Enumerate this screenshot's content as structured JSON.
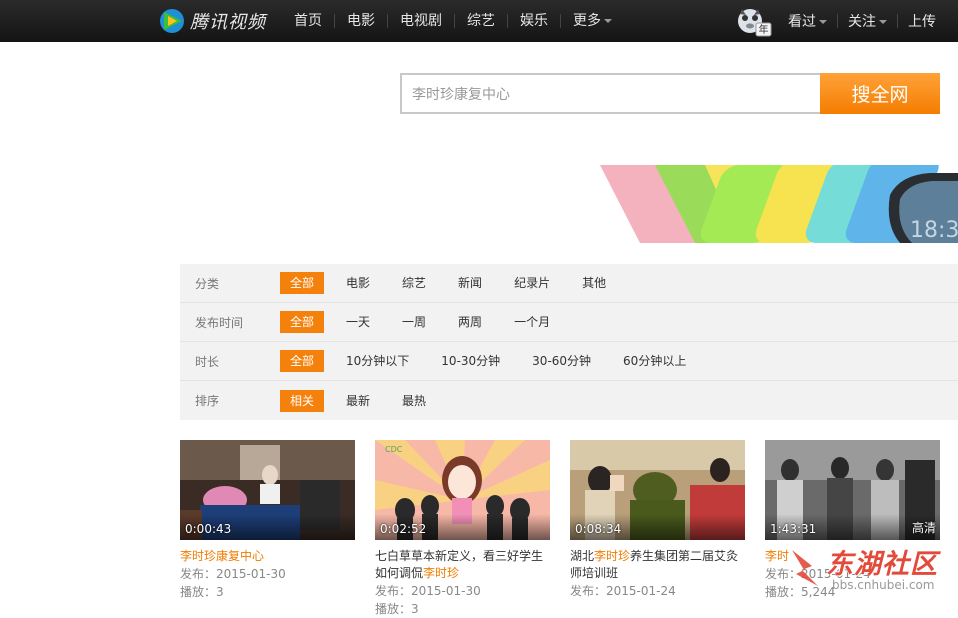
{
  "header": {
    "logo_text": "腾讯视频",
    "nav": [
      "首页",
      "电影",
      "电视剧",
      "综艺",
      "娱乐",
      "更多"
    ],
    "user_menu": [
      "看过",
      "关注",
      "上传"
    ],
    "avatar_badge": "年"
  },
  "search": {
    "value": "李时珍康复中心",
    "button_label": "搜全网"
  },
  "filters": [
    {
      "label": "分类",
      "options": [
        "全部",
        "电影",
        "综艺",
        "新闻",
        "纪录片",
        "其他"
      ],
      "active": 0
    },
    {
      "label": "发布时间",
      "options": [
        "全部",
        "一天",
        "一周",
        "两周",
        "一个月"
      ],
      "active": 0
    },
    {
      "label": "时长",
      "options": [
        "全部",
        "10分钟以下",
        "10-30分钟",
        "30-60分钟",
        "60分钟以上"
      ],
      "active": 0
    },
    {
      "label": "排序",
      "options": [
        "相关",
        "最新",
        "最热"
      ],
      "active": 0
    }
  ],
  "videos": [
    {
      "duration": "0:00:43",
      "hd": "",
      "title_parts": [
        "",
        "李时珍康复中心",
        ""
      ],
      "publish": "发布：2015-01-30",
      "plays": "播放：3"
    },
    {
      "duration": "0:02:52",
      "hd": "",
      "title_parts": [
        "七白草草本新定义，看三好学生如何调侃",
        "李时珍",
        ""
      ],
      "publish": "发布：2015-01-30",
      "plays": "播放：3"
    },
    {
      "duration": "0:08:34",
      "hd": "",
      "title_parts": [
        "湖北",
        "李时珍",
        "养生集团第二届艾灸师培训班"
      ],
      "publish": "发布：2015-01-24",
      "plays": ""
    },
    {
      "duration": "1:43:31",
      "hd": "高清",
      "title_parts": [
        "",
        "李时",
        ""
      ],
      "publish": "发布：2015-01-24",
      "plays": "播放：5,244"
    }
  ],
  "watermark": {
    "text": "东湖社区",
    "url": "bbs.cnhubei.com"
  },
  "colors": {
    "accent": "#f5810d",
    "topbar": "#1a1a1a",
    "highlight": "#f07c00"
  }
}
